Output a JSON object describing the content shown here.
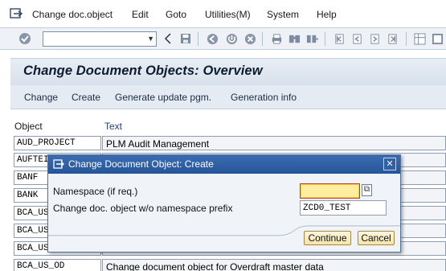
{
  "menu": {
    "items": [
      "Change doc.object",
      "Edit",
      "Goto",
      "Utilities(M)",
      "System",
      "Help"
    ]
  },
  "toolbar": {
    "command_field_value": ""
  },
  "page": {
    "title": "Change Document Objects: Overview"
  },
  "app_toolbar": {
    "buttons": [
      "Change",
      "Create",
      "Generate update pgm.",
      "Generation info"
    ]
  },
  "table": {
    "headers": [
      "Object",
      "Text"
    ],
    "rows": [
      {
        "object": "AUD_PROJECT",
        "text": "PLM Audit Management"
      },
      {
        "object": "AUFTEI",
        "text": ""
      },
      {
        "object": "BANF",
        "text": ""
      },
      {
        "object": "BANK",
        "text": ""
      },
      {
        "object": "BCA_US",
        "text": ""
      },
      {
        "object": "BCA_US",
        "text": ""
      },
      {
        "object": "BCA_US",
        "text": ""
      },
      {
        "object": "BCA_US_OD",
        "text": "Change document object for Overdraft master data"
      }
    ]
  },
  "dialog": {
    "title": "Change Document Object: Create",
    "namespace_label": "Namespace (if req.)",
    "namespace_value": "",
    "object_label": "Change doc. object w/o namespace prefix",
    "object_value": "ZCD0_TEST",
    "continue_label": "Continue",
    "cancel_label": "Cancel",
    "close_glyph": "✕"
  },
  "colors": {
    "dialog_title_bg": "#2f5fa5",
    "required_field_bg": "#ffeea0",
    "button_bg": "#f4e3aa",
    "header_link": "#1f3d8c"
  },
  "icons": [
    "enter-icon",
    "back-icon",
    "save-icon",
    "exit-icon",
    "cancel-icon",
    "print-icon",
    "find-icon",
    "find-next-icon",
    "first-page-icon",
    "prev-page-icon",
    "next-page-icon",
    "last-page-icon",
    "layout-icon",
    "help-icon"
  ]
}
